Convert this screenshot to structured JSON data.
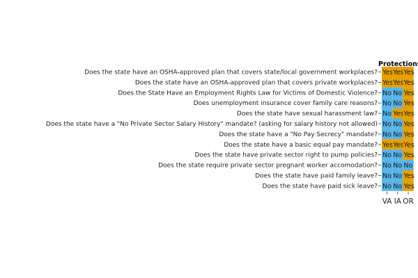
{
  "chart_data": {
    "type": "heatmap",
    "title": "Protections",
    "colors": {
      "Yes": "#E69F00",
      "No": "#56B4E9"
    },
    "states": [
      "VA",
      "IA",
      "OR"
    ],
    "rows": [
      {
        "question": "Does the state have an OSHA-approved plan that covers state/local government workplaces?",
        "values": [
          "Yes",
          "Yes",
          "Yes"
        ]
      },
      {
        "question": "Does the state have an OSHA-approved plan that covers private workplaces?",
        "values": [
          "Yes",
          "Yes",
          "Yes"
        ]
      },
      {
        "question": "Does the State Have an Employment Rights Law for Victims of Domestic Violence?",
        "values": [
          "No",
          "No",
          "Yes"
        ]
      },
      {
        "question": "Does unemployment insurance cover family care reasons?",
        "values": [
          "No",
          "No",
          "Yes"
        ]
      },
      {
        "question": "Does the state have sexual harassment law?",
        "values": [
          "No",
          "Yes",
          "Yes"
        ]
      },
      {
        "question": "Does the state have a \"No Private Sector Salary History\" mandate? (asking for salary history not allowed)",
        "values": [
          "No",
          "No",
          "Yes"
        ]
      },
      {
        "question": "Does the state have a \"No Pay Secrecy\" mandate?",
        "values": [
          "No",
          "No",
          "Yes"
        ]
      },
      {
        "question": "Does the state have a basic equal pay mandate?",
        "values": [
          "Yes",
          "Yes",
          "Yes"
        ]
      },
      {
        "question": "Does the state have private sector right to pump policies?",
        "values": [
          "No",
          "No",
          "Yes"
        ]
      },
      {
        "question": "Does the state require private sector pregnant worker accomodation?",
        "values": [
          "No",
          "No",
          "No"
        ]
      },
      {
        "question": "Does the state have paid family leave?",
        "values": [
          "No",
          "No",
          "Yes"
        ]
      },
      {
        "question": "Does the state have paid sick leave?",
        "values": [
          "No",
          "No",
          "Yes"
        ]
      }
    ]
  }
}
